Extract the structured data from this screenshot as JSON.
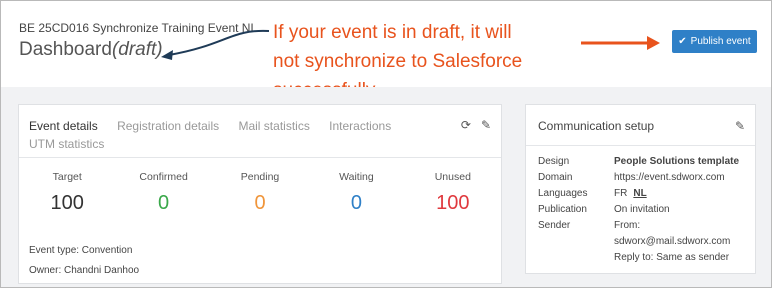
{
  "header": {
    "event_title": "BE 25CD016 Synchronize Training Event NL",
    "dashboard_label": "Dashboard",
    "draft_label": "(draft)",
    "publish_label": "Publish event"
  },
  "annotation": {
    "line1": "If your event is in draft, it will",
    "line2": "not synchronize to Salesforce",
    "line3": "successfully,",
    "color": "#e8531d"
  },
  "tabs": {
    "items": [
      {
        "label": "Event details"
      },
      {
        "label": "Registration details"
      },
      {
        "label": "Mail statistics"
      },
      {
        "label": "Interactions"
      },
      {
        "label": "UTM statistics"
      }
    ],
    "refresh_icon": "refresh-icon",
    "edit_icon": "pencil-icon"
  },
  "stats": [
    {
      "label": "Target",
      "value": "100",
      "color": "#333333"
    },
    {
      "label": "Confirmed",
      "value": "0",
      "color": "#3aa84a"
    },
    {
      "label": "Pending",
      "value": "0",
      "color": "#f0953a"
    },
    {
      "label": "Waiting",
      "value": "0",
      "color": "#2f80c7"
    },
    {
      "label": "Unused",
      "value": "100",
      "color": "#e0393e"
    }
  ],
  "meta": {
    "event_type": "Event type:  Convention",
    "owner": "Owner:  Chandni Danhoo"
  },
  "communication": {
    "title": "Communication setup",
    "design_label": "Design",
    "design_value": "People Solutions template",
    "domain_label": "Domain",
    "domain_value": "https://event.sdworx.com",
    "languages_label": "Languages",
    "lang_fr": "FR",
    "lang_nl": "NL",
    "publication_label": "Publication",
    "publication_value": "On invitation",
    "sender_label": "Sender",
    "sender_from": "From:",
    "sender_email": "sdworx@mail.sdworx.com",
    "sender_reply": "Reply to: Same as sender"
  }
}
